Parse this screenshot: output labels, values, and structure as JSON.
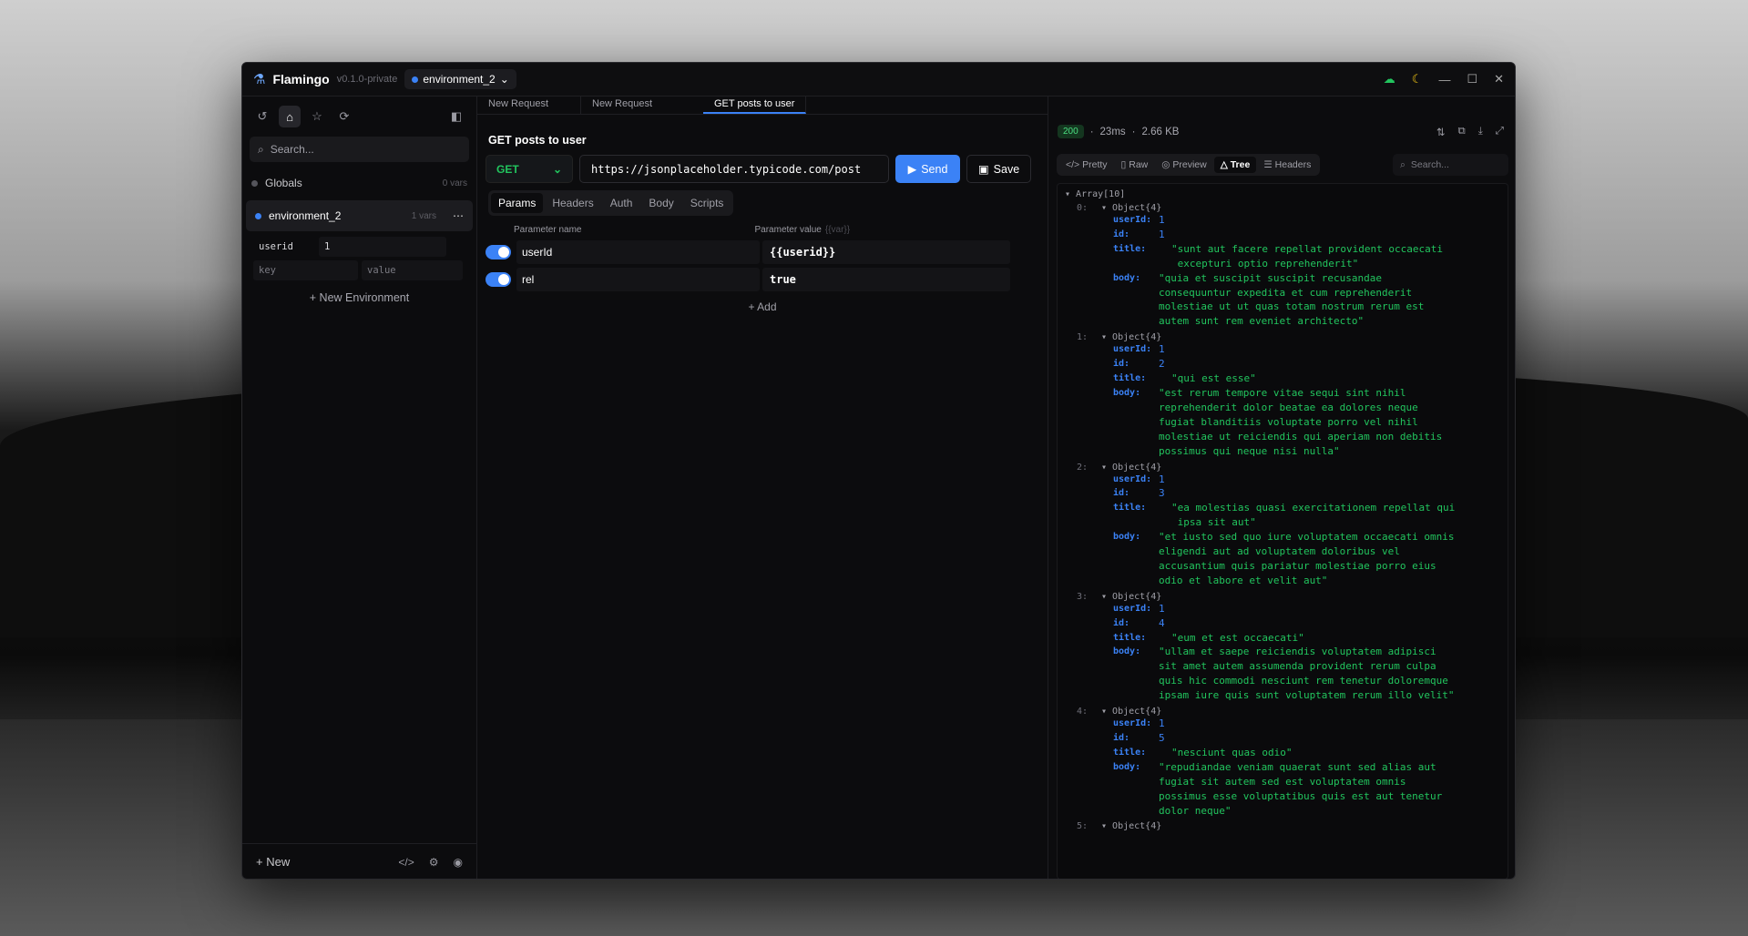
{
  "app": {
    "name": "Flamingo",
    "version": "v0.1.0-private",
    "env": "environment_2"
  },
  "sidebar": {
    "search_placeholder": "Search...",
    "globals": {
      "label": "Globals",
      "count": "0 vars"
    },
    "environment": {
      "label": "environment_2",
      "count": "1 vars"
    },
    "var": {
      "key": "userid",
      "value": "1"
    },
    "new_var": {
      "key_placeholder": "key",
      "value_placeholder": "value"
    },
    "new_env": "+ New Environment",
    "new": "+ New"
  },
  "tabs": [
    "New Request",
    "New Request",
    "GET posts to user"
  ],
  "request": {
    "title": "GET posts to user",
    "method": "GET",
    "url": "https://jsonplaceholder.typicode.com/post",
    "send": "Send",
    "save": "Save",
    "tabs": [
      "Params",
      "Headers",
      "Auth",
      "Body",
      "Scripts"
    ],
    "param_name_header": "Parameter name",
    "param_value_header": "Parameter value",
    "param_value_hint": "{{var}}",
    "params": [
      {
        "name": "userId",
        "value": "{{userid}}"
      },
      {
        "name": "rel",
        "value": "true"
      }
    ],
    "add": "+ Add"
  },
  "response": {
    "status": "200",
    "time": "23ms",
    "size": "2.66 KB",
    "views": [
      "Pretty",
      "Raw",
      "Preview",
      "Tree",
      "Headers"
    ],
    "search_placeholder": "Search...",
    "root": "Array[10]",
    "object_label": "Object{4}",
    "items": [
      {
        "idx": "0:",
        "userId": "1",
        "id": "1",
        "title": "\"sunt aut facere repellat provident occaecati\n excepturi optio reprehenderit\"",
        "body": "\"quia et suscipit suscipit recusandae\nconsequuntur expedita et cum reprehenderit\nmolestiae ut ut quas totam nostrum rerum est\nautem sunt rem eveniet architecto\""
      },
      {
        "idx": "1:",
        "userId": "1",
        "id": "2",
        "title": "\"qui est esse\"",
        "body": "\"est rerum tempore vitae sequi sint nihil\nreprehenderit dolor beatae ea dolores neque\nfugiat blanditiis voluptate porro vel nihil\nmolestiae ut reiciendis qui aperiam non debitis\npossimus qui neque nisi nulla\""
      },
      {
        "idx": "2:",
        "userId": "1",
        "id": "3",
        "title": "\"ea molestias quasi exercitationem repellat qui\n ipsa sit aut\"",
        "body": "\"et iusto sed quo iure voluptatem occaecati omnis\neligendi aut ad voluptatem doloribus vel\naccusantium quis pariatur molestiae porro eius\nodio et labore et velit aut\""
      },
      {
        "idx": "3:",
        "userId": "1",
        "id": "4",
        "title": "\"eum et est occaecati\"",
        "body": "\"ullam et saepe reiciendis voluptatem adipisci\nsit amet autem assumenda provident rerum culpa\nquis hic commodi nesciunt rem tenetur doloremque\nipsam iure quis sunt voluptatem rerum illo velit\""
      },
      {
        "idx": "4:",
        "userId": "1",
        "id": "5",
        "title": "\"nesciunt quas odio\"",
        "body": "\"repudiandae veniam quaerat sunt sed alias aut\nfugiat sit autem sed est voluptatem omnis\npossimus esse voluptatibus quis est aut tenetur\ndolor neque\""
      }
    ],
    "next_idx": "5:"
  }
}
